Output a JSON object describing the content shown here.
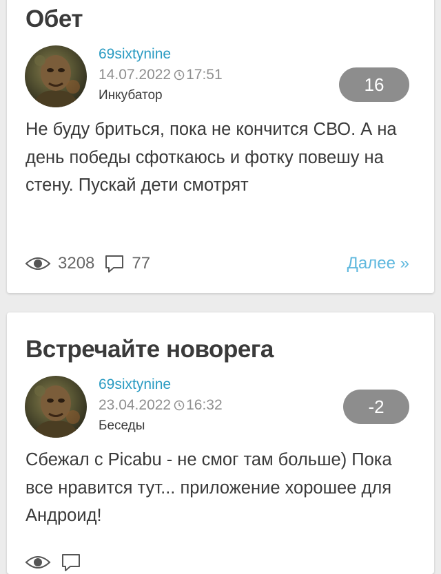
{
  "posts": [
    {
      "title": "Обет",
      "author": "69sixtynine",
      "date": "14.07.2022",
      "time": "17:51",
      "community": "Инкубатор",
      "rating": "16",
      "body": "Не буду бриться, пока не кончится СВО. А на день победы сфоткаюсь и фотку повешу на стену. Пускай дети смотрят",
      "views": "3208",
      "comments": "77",
      "more_label": "Далее »"
    },
    {
      "title": "Встречайте новорега",
      "author": "69sixtynine",
      "date": "23.04.2022",
      "time": "16:32",
      "community": "Беседы",
      "rating": "-2",
      "body": "Сбежал с Picabu - не смог там больше) Пока все нравится тут... приложение хорошее для Андроид!"
    }
  ],
  "icons": {
    "views": "eye-icon",
    "comments": "comment-bubble-icon",
    "time": "clock-icon"
  },
  "colors": {
    "author_link": "#2a9bc2",
    "more_link": "#5fb8de",
    "rating_badge": "#8d8d8d"
  }
}
